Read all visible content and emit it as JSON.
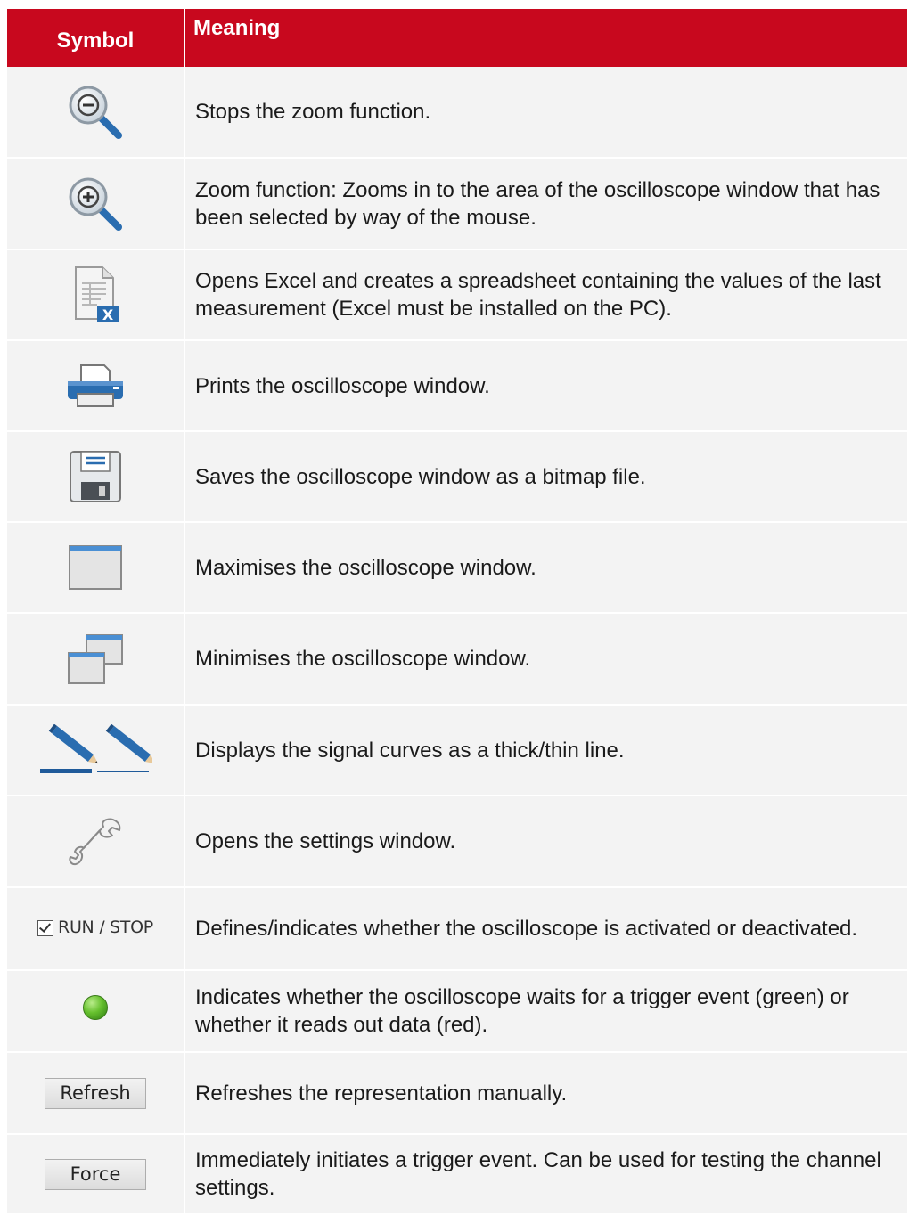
{
  "header": {
    "symbol": "Symbol",
    "meaning": "Meaning"
  },
  "colors": {
    "header_bg": "#c8081e",
    "row_bg": "#f3f3f3",
    "icon_blue": "#2a6db0"
  },
  "rows": [
    {
      "icon": "zoom-out-icon",
      "meaning": "Stops the zoom function."
    },
    {
      "icon": "zoom-in-icon",
      "meaning": "Zoom function: Zooms in to the area of the oscilloscope window that has been selected by way of the mouse."
    },
    {
      "icon": "excel-export-icon",
      "meaning": "Opens Excel and creates a spreadsheet containing the values of the last measurement (Excel must be installed on the PC)."
    },
    {
      "icon": "printer-icon",
      "meaning": "Prints the oscilloscope window."
    },
    {
      "icon": "save-icon",
      "meaning": "Saves the oscilloscope window as a bitmap file."
    },
    {
      "icon": "maximize-window-icon",
      "meaning": "Maximises the oscilloscope window."
    },
    {
      "icon": "minimize-window-icon",
      "meaning": "Minimises the oscilloscope window."
    },
    {
      "icon": "line-thickness-icon",
      "meaning": "Displays the signal curves as a thick/thin line."
    },
    {
      "icon": "wrench-icon",
      "meaning": "Opens the settings window."
    },
    {
      "icon": "run-stop-checkbox",
      "label": "RUN / STOP",
      "meaning": "Defines/indicates whether the oscilloscope is activated or deactivated."
    },
    {
      "icon": "status-led-icon",
      "meaning": "Indicates whether the oscilloscope waits for a trigger event (green) or whether it reads out data (red)."
    },
    {
      "icon": "refresh-button",
      "label": "Refresh",
      "meaning": "Refreshes the representation manually."
    },
    {
      "icon": "force-button",
      "label": "Force",
      "meaning": "Immediately initiates a trigger event. Can be used for testing the channel settings."
    }
  ]
}
